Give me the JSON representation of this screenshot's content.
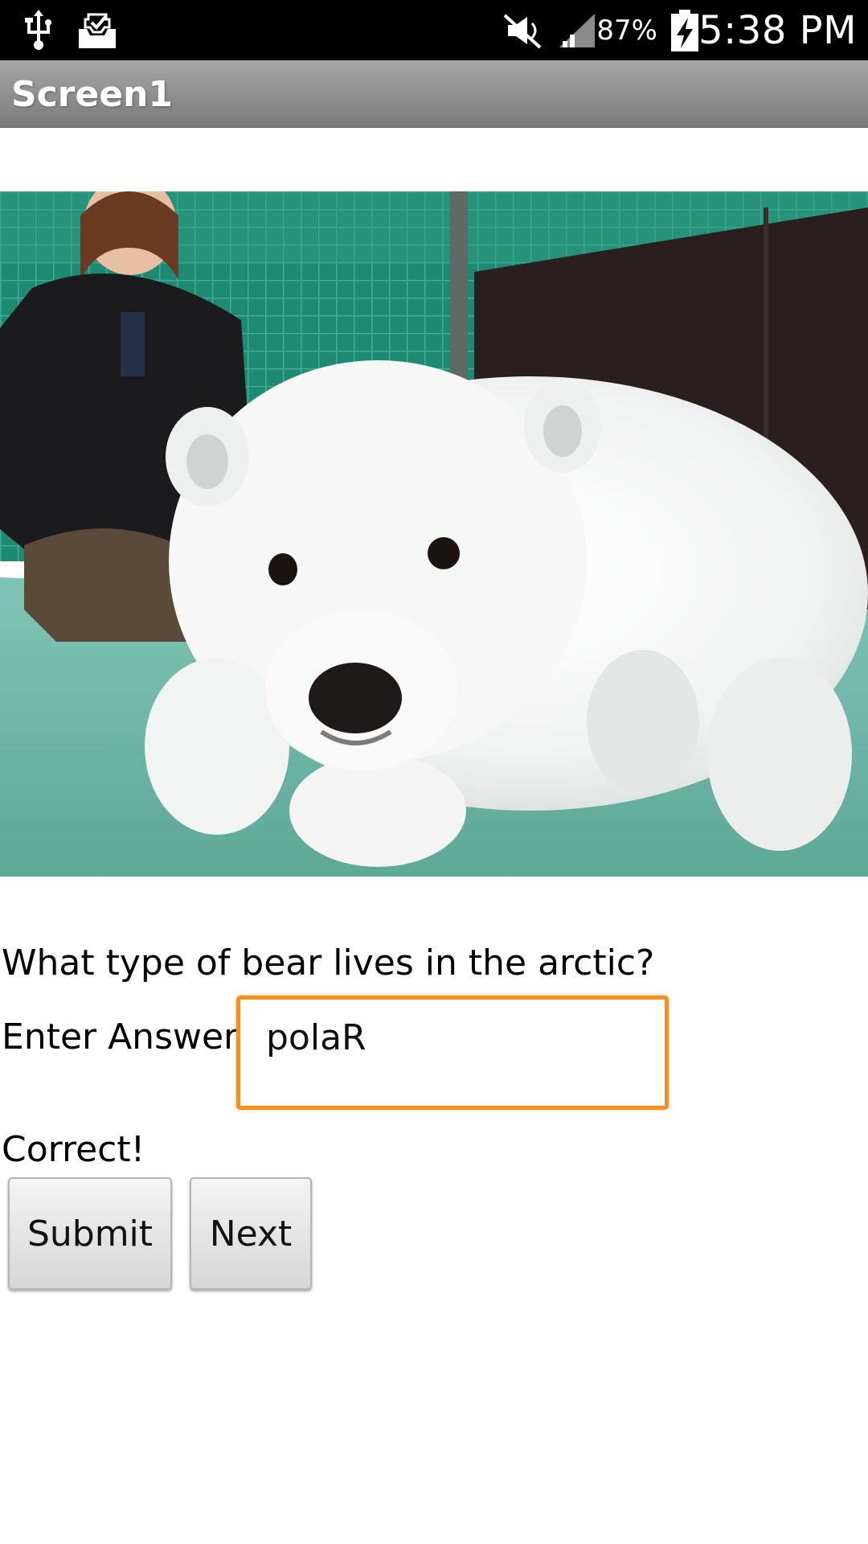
{
  "status_bar": {
    "icons": [
      "usb-icon",
      "inbox-icon",
      "mute-icon",
      "signal-icon",
      "battery-charging-icon"
    ],
    "battery_percent": "87%",
    "time": "5:38 PM"
  },
  "app": {
    "title": "Screen1"
  },
  "image": {
    "description_icon": "polar-bear-cub-photo"
  },
  "quiz": {
    "question": "What type of bear lives in the arctic?",
    "answer_label": "Enter Answer:",
    "answer_value": "polaR",
    "result": "Correct!",
    "submit_label": "Submit",
    "next_label": "Next"
  },
  "colors": {
    "status_bar_bg": "#000000",
    "title_bar_bg": "#8c8c8c",
    "input_focus_border": "#f5901e",
    "button_bg": "#e0e0e0"
  }
}
